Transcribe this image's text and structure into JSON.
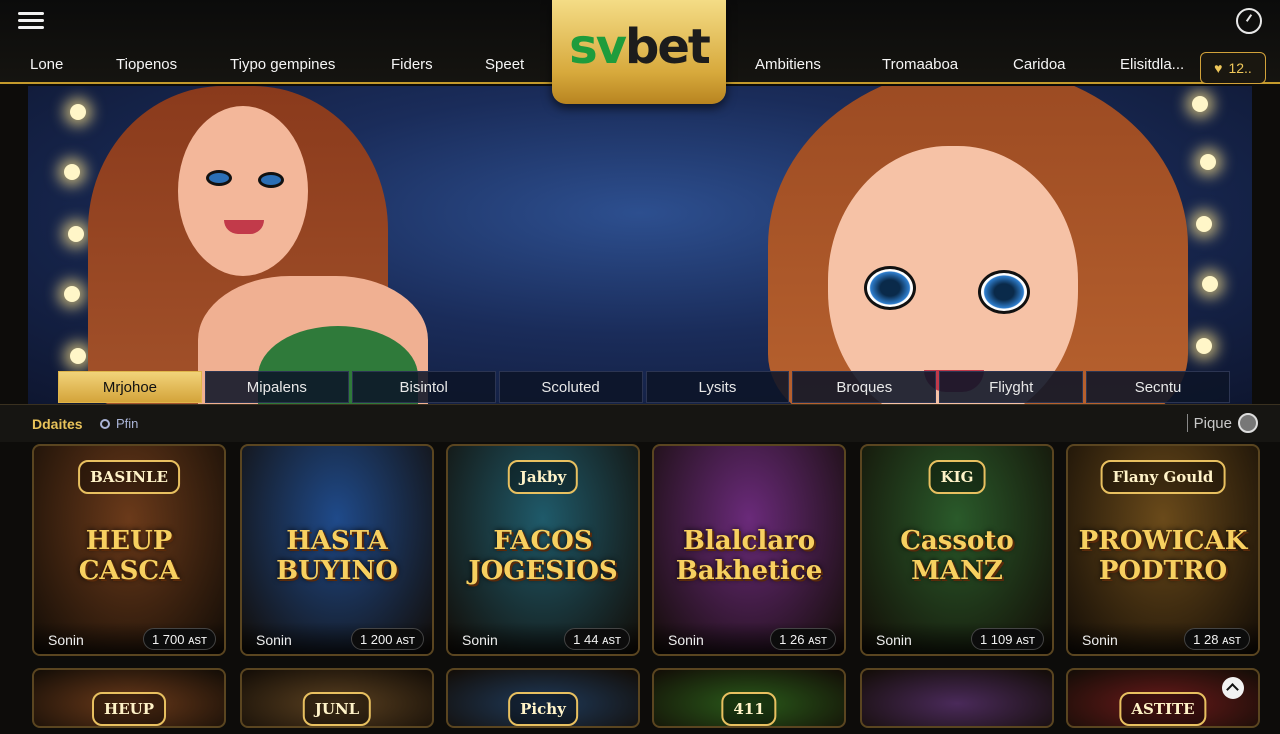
{
  "header": {
    "logo_left": "sv",
    "logo_right": "bet",
    "nav": [
      "Lone",
      "Tiopenos",
      "Tiypo gempines",
      "Fiders",
      "Speet",
      "Ambitiens",
      "Tromaaboa",
      "Caridoa",
      "Elisitdla..."
    ],
    "balance": "12.."
  },
  "hero": {
    "tabs": [
      "Mrjohoe",
      "Mipalens",
      "Bisintol",
      "Scoluted",
      "Lysits",
      "Broques",
      "Fliyght",
      "Secntu"
    ],
    "active_tab": "Mrjohoe"
  },
  "section": {
    "title": "Ddaites",
    "filter_label": "Pfin",
    "sort_label": "Pique"
  },
  "games": [
    {
      "badge": "BASINLE",
      "title": "HEUP CASCA",
      "provider": "Sonin",
      "price": "1 700 ᴀsᴛ",
      "bg": "#6b3a1a"
    },
    {
      "badge": "",
      "title": "HASTA BUYINO",
      "provider": "Sonin",
      "price": "1 200 ᴀsᴛ",
      "bg": "#1f4a8a"
    },
    {
      "badge": "Jakby",
      "title": "FACOS JOGESIOS",
      "provider": "Sonin",
      "price": "1 44 ᴀsᴛ",
      "bg": "#1f5a6a"
    },
    {
      "badge": "",
      "title": "Blalclaro Bakhetice",
      "provider": "Sonin",
      "price": "1 26 ᴀsᴛ",
      "bg": "#6a2a7a"
    },
    {
      "badge": "KIG",
      "title": "Cassoto MANZ",
      "provider": "Sonin",
      "price": "1 109 ᴀsᴛ",
      "bg": "#2a5a2a"
    },
    {
      "badge": "Flany Gould",
      "title": "PROWICAK PODTRO",
      "provider": "Sonin",
      "price": "1 28 ᴀsᴛ",
      "bg": "#6a4a1a"
    }
  ],
  "games_row2": [
    {
      "badge": "HEUP",
      "bg": "#6b3a1a"
    },
    {
      "badge": "JUNL",
      "bg": "#5a4020"
    },
    {
      "badge": "Pichy",
      "bg": "#1f3a5a"
    },
    {
      "badge": "411",
      "bg": "#2a5a1a"
    },
    {
      "badge": "",
      "bg": "#4a2a5a"
    },
    {
      "badge": "ASTITE",
      "bg": "#6a1a1a"
    }
  ]
}
